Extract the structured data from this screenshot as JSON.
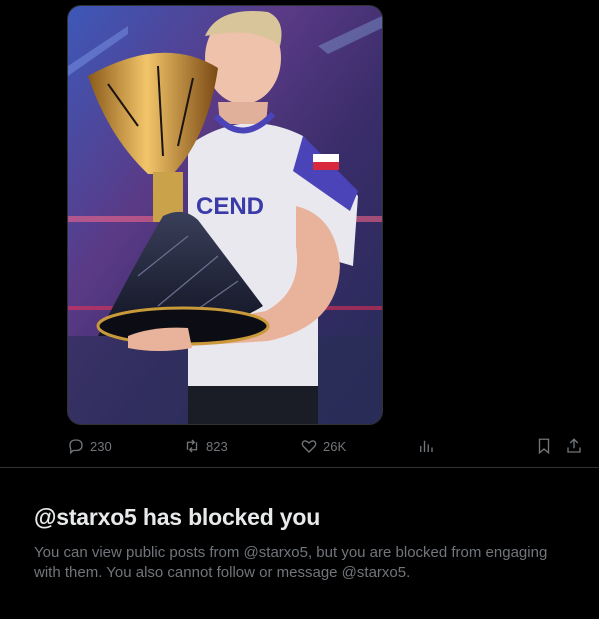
{
  "actions": {
    "replies": "230",
    "reposts": "823",
    "likes": "26K"
  },
  "blocked": {
    "title": "@starxo5 has blocked you",
    "message": "You can view public posts from @starxo5, but you are blocked from engaging with them. You also cannot follow or message @starxo5."
  },
  "media": {
    "jersey_text": "CEND"
  },
  "colors": {
    "background": "#000000",
    "muted": "#71767b",
    "text": "#e7e9ea",
    "border": "#2f3336"
  },
  "icons": [
    "reply-icon",
    "repost-icon",
    "like-icon",
    "views-icon",
    "bookmark-icon",
    "share-icon"
  ]
}
